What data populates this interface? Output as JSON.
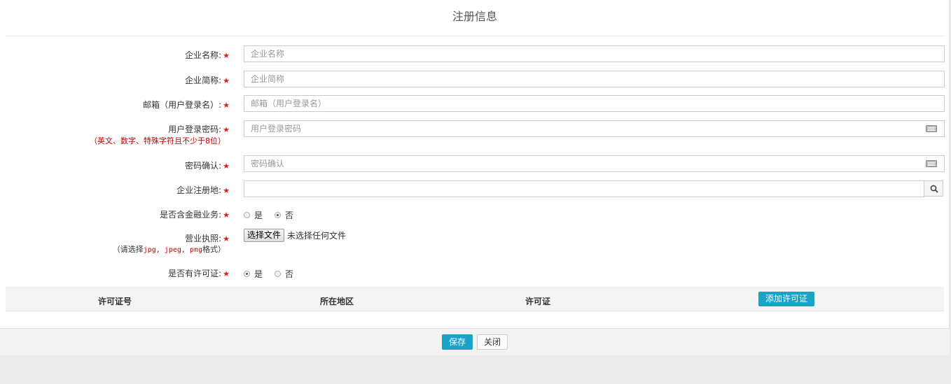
{
  "dialog": {
    "title": "注册信息"
  },
  "form": {
    "company_name": {
      "label": "企业名称:",
      "placeholder": "企业名称",
      "value": ""
    },
    "company_short": {
      "label": "企业简称:",
      "placeholder": "企业简称",
      "value": ""
    },
    "email": {
      "label": "邮箱（用户登录名）:",
      "placeholder": "邮箱（用户登录名）",
      "value": ""
    },
    "password": {
      "label": "用户登录密码:",
      "hint": "（英文、数字、特殊字符且不少于8位）",
      "placeholder": "用户登录密码",
      "icon": "keyboard-icon"
    },
    "password_confirm": {
      "label": "密码确认:",
      "placeholder": "密码确认",
      "icon": "keyboard-icon"
    },
    "reg_place": {
      "label": "企业注册地:",
      "value": "",
      "icon": "search-icon"
    },
    "financial": {
      "label": "是否含金融业务:",
      "options": [
        "是",
        "否"
      ],
      "selected": "否"
    },
    "license": {
      "label": "营业执照:",
      "hint_prefix": "（请选择",
      "hint_formats": "jpg, jpeg, png",
      "hint_suffix": "格式）",
      "button_label": "选择文件",
      "status": "未选择任何文件"
    },
    "has_permit": {
      "label": "是否有许可证:",
      "options": [
        "是",
        "否"
      ],
      "selected": "是"
    },
    "required_mark": "★"
  },
  "permit_table": {
    "columns": [
      "许可证号",
      "所在地区",
      "许可证"
    ],
    "add_button": "添加许可证"
  },
  "footer": {
    "save_label": "保存",
    "close_label": "关闭"
  },
  "colors": {
    "accent": "#1aa2c7",
    "required": "#e02020",
    "hint_red": "#c00000"
  }
}
